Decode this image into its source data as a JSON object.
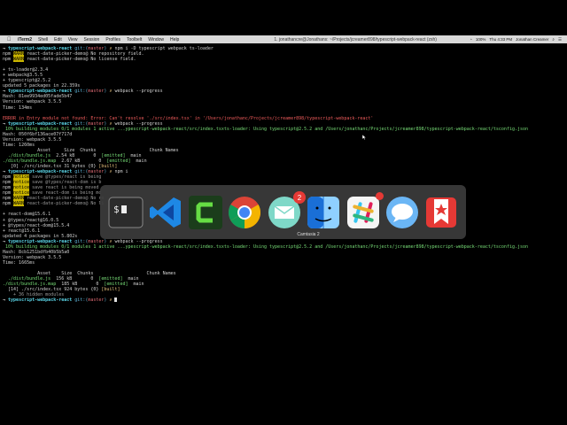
{
  "menubar": {
    "items": [
      "iTerm2",
      "Shell",
      "Edit",
      "View",
      "Session",
      "Profiles",
      "Toolbelt",
      "Window",
      "Help"
    ],
    "window_title": "1. jonathancre@Jonathans: ~/Projects/jcreamer898/typescript-webpack-react (zsh)",
    "status": {
      "battery": "100%",
      "time": "Thu 4:33 PM",
      "user": "Jonathan Creamer"
    }
  },
  "terminal": {
    "lines": [
      [
        [
          "$",
          "c-prompt",
          "→ "
        ],
        [
          "$",
          "c-dir",
          "typescript-webpack-react "
        ],
        [
          "$",
          "c-git",
          "git:("
        ],
        [
          "$",
          "c-branch",
          "master"
        ],
        [
          "$",
          "c-git",
          ") "
        ],
        [
          "$",
          "c-yellow",
          "✗ "
        ],
        [
          "$",
          "",
          "npm i -D typescript webpack ts-loader"
        ]
      ],
      [
        [
          "$",
          "",
          "npm "
        ],
        [
          "$",
          "c-warn",
          "WARN"
        ],
        [
          "$",
          "",
          " react-date-picker-demo@ No repository field."
        ]
      ],
      [
        [
          "$",
          "",
          "npm "
        ],
        [
          "$",
          "c-warn",
          "WARN"
        ],
        [
          "$",
          "",
          " react-date-picker-demo@ No license field."
        ]
      ],
      [
        [
          "$",
          "",
          ""
        ]
      ],
      [
        [
          "$",
          "",
          "+ ts-loader@2.3.4"
        ]
      ],
      [
        [
          "$",
          "",
          "+ webpack@3.5.5"
        ]
      ],
      [
        [
          "$",
          "",
          "+ typescript@2.5.2"
        ]
      ],
      [
        [
          "$",
          "",
          "updated 5 packages in 22.359s"
        ]
      ],
      [
        [
          "$",
          "c-prompt",
          "→ "
        ],
        [
          "$",
          "c-dir",
          "typescript-webpack-react "
        ],
        [
          "$",
          "c-git",
          "git:("
        ],
        [
          "$",
          "c-branch",
          "master"
        ],
        [
          "$",
          "c-git",
          ") "
        ],
        [
          "$",
          "c-yellow",
          "✗ "
        ],
        [
          "$",
          "",
          "webpack --progress"
        ]
      ],
      [
        [
          "$",
          "",
          "Hash: 81ee9934ed05fade5b47"
        ]
      ],
      [
        [
          "$",
          "",
          "Version: webpack 3.5.5"
        ]
      ],
      [
        [
          "$",
          "",
          "Time: 134ms"
        ]
      ],
      [
        [
          "$",
          "",
          ""
        ]
      ],
      [
        [
          "$",
          "c-err",
          "ERROR in Entry module not found: Error: Can't resolve './src/index.tsx' in '/Users/jonathanc/Projects/jcreamer898/typescript-webpack-react'"
        ]
      ],
      [
        [
          "$",
          "c-prompt",
          "→ "
        ],
        [
          "$",
          "c-dir",
          "typescript-webpack-react "
        ],
        [
          "$",
          "c-git",
          "git:("
        ],
        [
          "$",
          "c-branch",
          "master"
        ],
        [
          "$",
          "c-git",
          ") "
        ],
        [
          "$",
          "c-yellow",
          "✗ "
        ],
        [
          "$",
          "",
          "webpack --progress"
        ]
      ],
      [
        [
          "$",
          "c-green",
          " 10% building modules 0/1 modules 1 active ...ypescript-webpack-react/src/index.tsxts-loader: Using typescript@2.5.2 and /Users/jonathanc/Projects/jcreamer898/typescript-webpack-react/tsconfig.json"
        ]
      ],
      [
        [
          "$",
          "",
          "Hash: 050f6bf136ace07f717d"
        ]
      ],
      [
        [
          "$",
          "",
          "Version: webpack 3.5.5"
        ]
      ],
      [
        [
          "$",
          "",
          "Time: 1260ms"
        ]
      ],
      [
        [
          "$",
          "",
          "             Asset     Size  Chunks                    Chunk Names"
        ]
      ],
      [
        [
          "$",
          "c-green",
          "  ./dist/bundle.js"
        ],
        [
          "$",
          "",
          "  2.54 kB       0  "
        ],
        [
          "$",
          "c-green",
          "[emitted]"
        ],
        [
          "$",
          "",
          "  main"
        ]
      ],
      [
        [
          "$",
          "c-green",
          "./dist/bundle.js.map"
        ],
        [
          "$",
          "",
          "  2.67 kB       0  "
        ],
        [
          "$",
          "c-green",
          "[emitted]"
        ],
        [
          "$",
          "",
          "  main"
        ]
      ],
      [
        [
          "$",
          "",
          "   [0] ./src/index.tsx 31 bytes {0} "
        ],
        [
          "$",
          "c-yellow",
          "[built]"
        ]
      ],
      [
        [
          "$",
          "c-prompt",
          "→ "
        ],
        [
          "$",
          "c-dir",
          "typescript-webpack-react "
        ],
        [
          "$",
          "c-git",
          "git:("
        ],
        [
          "$",
          "c-branch",
          "master"
        ],
        [
          "$",
          "c-git",
          ") "
        ],
        [
          "$",
          "c-yellow",
          "✗ "
        ],
        [
          "$",
          "",
          "npm i"
        ]
      ],
      [
        [
          "$",
          "",
          "npm "
        ],
        [
          "$",
          "c-warn",
          "notice"
        ],
        [
          "$",
          "c-dim",
          " save @types/react is being"
        ]
      ],
      [
        [
          "$",
          "",
          "npm "
        ],
        [
          "$",
          "c-warn",
          "notice"
        ],
        [
          "$",
          "c-dim",
          " save @types/react-dom is b"
        ]
      ],
      [
        [
          "$",
          "",
          "npm "
        ],
        [
          "$",
          "c-warn",
          "notice"
        ],
        [
          "$",
          "c-dim",
          " save react is being moved"
        ]
      ],
      [
        [
          "$",
          "",
          "npm "
        ],
        [
          "$",
          "c-warn",
          "notice"
        ],
        [
          "$",
          "c-dim",
          " save react-dom is being mo"
        ]
      ],
      [
        [
          "$",
          "",
          "npm "
        ],
        [
          "$",
          "c-warn",
          "WARN"
        ],
        [
          "$",
          "c-dim",
          " react-date-picker-demo@ No re"
        ]
      ],
      [
        [
          "$",
          "",
          "npm "
        ],
        [
          "$",
          "c-warn",
          "WARN"
        ],
        [
          "$",
          "c-dim",
          " react-date-picker-demo@ No li"
        ]
      ],
      [
        [
          "$",
          "",
          ""
        ]
      ],
      [
        [
          "$",
          "",
          "+ react-dom@15.6.1"
        ]
      ],
      [
        [
          "$",
          "",
          "+ @types/react@16.0.5"
        ]
      ],
      [
        [
          "$",
          "",
          "+ @types/react-dom@15.5.4"
        ]
      ],
      [
        [
          "$",
          "",
          "+ react@15.6.1"
        ]
      ],
      [
        [
          "$",
          "",
          "updated 4 packages in 5.802s"
        ]
      ],
      [
        [
          "$",
          "c-prompt",
          "→ "
        ],
        [
          "$",
          "c-dir",
          "typescript-webpack-react "
        ],
        [
          "$",
          "c-git",
          "git:("
        ],
        [
          "$",
          "c-branch",
          "master"
        ],
        [
          "$",
          "c-git",
          ") "
        ],
        [
          "$",
          "c-yellow",
          "✗ "
        ],
        [
          "$",
          "",
          "webpack --progress"
        ]
      ],
      [
        [
          "$",
          "c-green",
          " 10% building modules 0/1 modules 1 active ...ypescript-webpack-react/src/index.tsxts-loader: Using typescript@2.5.2 and /Users/jonathanc/Projects/jcreamer898/typescript-webpack-react/tsconfig.json"
        ]
      ],
      [
        [
          "$",
          "",
          "Hash: 8cb1251bdfb40b5b5a0"
        ]
      ],
      [
        [
          "$",
          "",
          "Version: webpack 3.5.5"
        ]
      ],
      [
        [
          "$",
          "",
          "Time: 1665ms"
        ]
      ],
      [
        [
          "$",
          "",
          ""
        ]
      ],
      [
        [
          "$",
          "",
          "             Asset    Size  Chunks                    Chunk Names"
        ]
      ],
      [
        [
          "$",
          "c-green",
          "  ./dist/bundle.js"
        ],
        [
          "$",
          "",
          "  156 kB       0  "
        ],
        [
          "$",
          "c-green",
          "[emitted]"
        ],
        [
          "$",
          "",
          "  main"
        ]
      ],
      [
        [
          "$",
          "c-green",
          "./dist/bundle.js.map"
        ],
        [
          "$",
          "",
          "  185 kB       0  "
        ],
        [
          "$",
          "c-green",
          "[emitted]"
        ],
        [
          "$",
          "",
          "  main"
        ]
      ],
      [
        [
          "$",
          "",
          "  [14] ./src/index.tsx 924 bytes {0} "
        ],
        [
          "$",
          "c-yellow",
          "[built]"
        ]
      ],
      [
        [
          "$",
          "c-dim",
          "    + 36 hidden modules"
        ]
      ],
      [
        [
          "$",
          "c-prompt",
          "→ "
        ],
        [
          "$",
          "c-dir",
          "typescript-webpack-react "
        ],
        [
          "$",
          "c-git",
          "git:("
        ],
        [
          "$",
          "c-branch",
          "master"
        ],
        [
          "$",
          "c-git",
          ") "
        ],
        [
          "$",
          "c-yellow",
          "✗ "
        ],
        [
          "$",
          "cursor",
          ""
        ]
      ]
    ]
  },
  "dock": {
    "hover_label": "Camtasia 2",
    "apps": [
      {
        "name": "terminal",
        "badge": ""
      },
      {
        "name": "vscode",
        "badge": ""
      },
      {
        "name": "camtasia",
        "badge": ""
      },
      {
        "name": "chrome",
        "badge": ""
      },
      {
        "name": "mail",
        "badge": "2"
      },
      {
        "name": "finder",
        "badge": ""
      },
      {
        "name": "slack",
        "badge": ""
      },
      {
        "name": "messages",
        "badge": ""
      },
      {
        "name": "wunderlist",
        "badge": ""
      }
    ],
    "colors": {
      "accent": "#e53935"
    }
  }
}
